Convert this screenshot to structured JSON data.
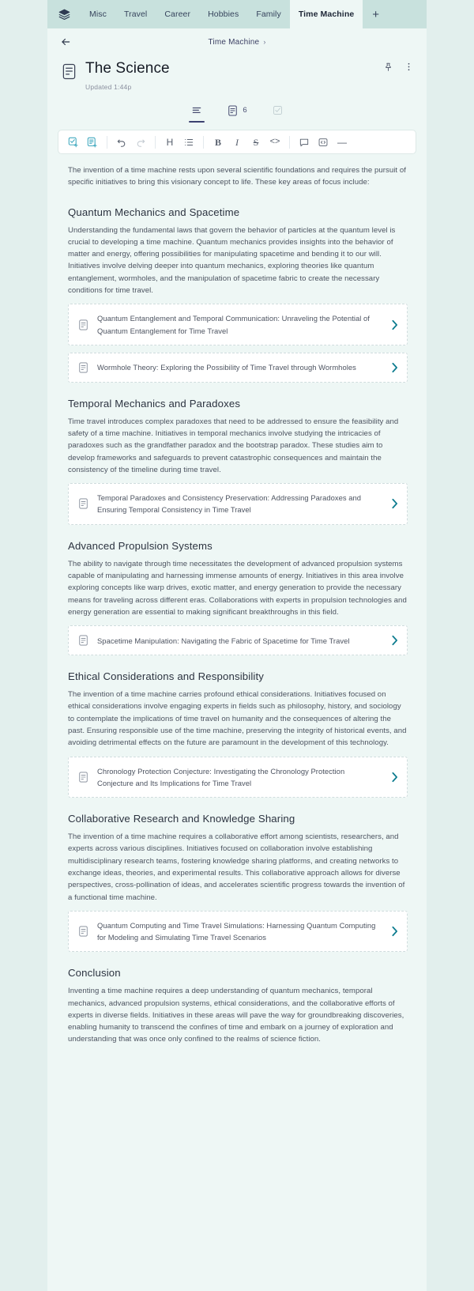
{
  "window": {
    "logo_icon": "layers-icon"
  },
  "tabstrip": {
    "tabs": [
      {
        "label": "Misc",
        "active": false
      },
      {
        "label": "Travel",
        "active": false
      },
      {
        "label": "Career",
        "active": false
      },
      {
        "label": "Hobbies",
        "active": false
      },
      {
        "label": "Family",
        "active": false
      },
      {
        "label": "Time Machine",
        "active": true
      }
    ],
    "add_label": "+"
  },
  "header": {
    "back_icon": "arrow-left-icon",
    "breadcrumb": "Time Machine",
    "breadcrumb_chevron": "›",
    "title": "The Science",
    "title_icon": "note-document-icon",
    "updated": "Updated 1:44p",
    "pin_icon": "pin-icon",
    "more_icon": "more-vertical-icon"
  },
  "view_tabs": [
    {
      "name": "outline-tab",
      "icon": "text-lines-icon",
      "count": "",
      "active": true,
      "muted": false
    },
    {
      "name": "notes-tab",
      "icon": "note-document-icon",
      "count": "6",
      "active": false,
      "muted": false
    },
    {
      "name": "tasks-tab",
      "icon": "checkbox-icon",
      "count": "",
      "active": false,
      "muted": true
    }
  ],
  "toolbar": {
    "buttons": [
      {
        "name": "add-task-button",
        "icon": "checkbox-plus-icon",
        "style": "accent"
      },
      {
        "name": "add-note-button",
        "icon": "note-plus-icon",
        "style": "accent"
      },
      {
        "name": "undo-button",
        "icon": "undo-icon",
        "style": "normal"
      },
      {
        "name": "redo-button",
        "icon": "redo-icon",
        "style": "dim"
      },
      {
        "name": "heading-button",
        "icon": "heading-h-icon",
        "label": "H",
        "style": "normal"
      },
      {
        "name": "bullet-list-button",
        "icon": "bullet-list-icon",
        "style": "normal"
      },
      {
        "name": "bold-button",
        "icon": "bold-icon",
        "label": "B",
        "style": "normal"
      },
      {
        "name": "italic-button",
        "icon": "italic-icon",
        "label": "I",
        "style": "normal"
      },
      {
        "name": "strikethrough-button",
        "icon": "strikethrough-icon",
        "label": "S",
        "style": "normal"
      },
      {
        "name": "inline-code-button",
        "icon": "code-angle-brackets-icon",
        "label": "<>",
        "style": "normal"
      },
      {
        "name": "comment-button",
        "icon": "comment-bubble-icon",
        "style": "normal"
      },
      {
        "name": "code-block-button",
        "icon": "code-block-icon",
        "style": "normal"
      },
      {
        "name": "divider-button",
        "icon": "horizontal-rule-icon",
        "label": "—",
        "style": "normal"
      }
    ]
  },
  "document": {
    "intro": "The invention of a time machine rests upon several scientific foundations and requires the pursuit of specific initiatives to bring this visionary concept to life. These key areas of focus include:",
    "sections": [
      {
        "heading": "Quantum Mechanics and Spacetime",
        "body": "Understanding the fundamental laws that govern the behavior of particles at the quantum level is crucial to developing a time machine. Quantum mechanics provides insights into the behavior of matter and energy, offering possibilities for manipulating spacetime and bending it to our will. Initiatives involve delving deeper into quantum mechanics, exploring theories like quantum entanglement, wormholes, and the manipulation of spacetime fabric to create the necessary conditions for time travel.",
        "cards": [
          "Quantum Entanglement and Temporal Communication: Unraveling the Potential of Quantum Entanglement for Time Travel",
          "Wormhole Theory: Exploring the Possibility of Time Travel through Wormholes"
        ]
      },
      {
        "heading": "Temporal Mechanics and Paradoxes",
        "body": "Time travel introduces complex paradoxes that need to be addressed to ensure the feasibility and safety of a time machine. Initiatives in temporal mechanics involve studying the intricacies of paradoxes such as the grandfather paradox and the bootstrap paradox. These studies aim to develop frameworks and safeguards to prevent catastrophic consequences and maintain the consistency of the timeline during time travel.",
        "cards": [
          "Temporal Paradoxes and Consistency Preservation: Addressing Paradoxes and Ensuring Temporal Consistency in Time Travel"
        ]
      },
      {
        "heading": "Advanced Propulsion Systems",
        "body": "The ability to navigate through time necessitates the development of advanced propulsion systems capable of manipulating and harnessing immense amounts of energy. Initiatives in this area involve exploring concepts like warp drives, exotic matter, and energy generation to provide the necessary means for traveling across different eras. Collaborations with experts in propulsion technologies and energy generation are essential to making significant breakthroughs in this field.",
        "cards": [
          "Spacetime Manipulation: Navigating the Fabric of Spacetime for Time Travel"
        ]
      },
      {
        "heading": "Ethical Considerations and Responsibility",
        "body": "The invention of a time machine carries profound ethical considerations. Initiatives focused on ethical considerations involve engaging experts in fields such as philosophy, history, and sociology to contemplate the implications of time travel on humanity and the consequences of altering the past. Ensuring responsible use of the time machine, preserving the integrity of historical events, and avoiding detrimental effects on the future are paramount in the development of this technology.",
        "cards": [
          "Chronology Protection Conjecture: Investigating the Chronology Protection Conjecture and Its Implications for Time Travel"
        ]
      },
      {
        "heading": "Collaborative Research and Knowledge Sharing",
        "body": "The invention of a time machine requires a collaborative effort among scientists, researchers, and experts across various disciplines. Initiatives focused on collaboration involve establishing multidisciplinary research teams, fostering knowledge sharing platforms, and creating networks to exchange ideas, theories, and experimental results. This collaborative approach allows for diverse perspectives, cross-pollination of ideas, and accelerates scientific progress towards the invention of a functional time machine.",
        "cards": [
          "Quantum Computing and Time Travel Simulations: Harnessing Quantum Computing for Modeling and Simulating Time Travel Scenarios"
        ]
      },
      {
        "heading": "Conclusion",
        "body": "Inventing a time machine requires a deep understanding of quantum mechanics, temporal mechanics, advanced propulsion systems, ethical considerations, and the collaborative efforts of experts in diverse fields. Initiatives in these areas will pave the way for groundbreaking discoveries, enabling humanity to transcend the confines of time and embark on a journey of exploration and understanding that was once only confined to the realms of science fiction.",
        "cards": []
      }
    ]
  },
  "colors": {
    "app_bg": "#e2efed",
    "tabstrip_bg": "#c8e1dd",
    "panel_bg": "#eef7f5",
    "accent": "#2b9fb8",
    "chevron": "#0d7c8f",
    "heading": "#2c3340",
    "body_text": "#4c5360"
  }
}
